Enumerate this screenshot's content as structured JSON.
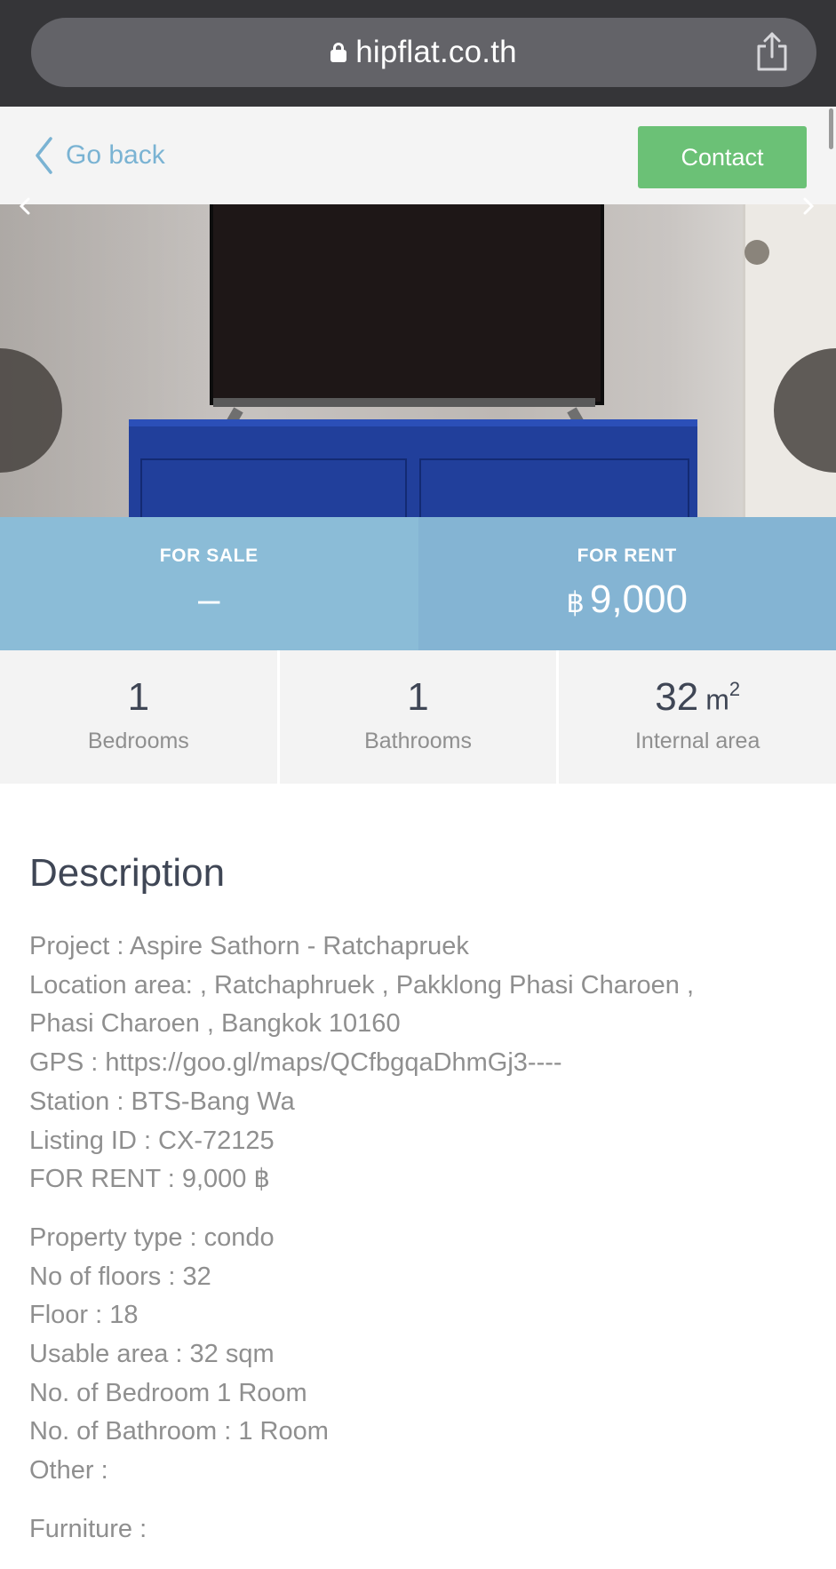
{
  "browser": {
    "url": "hipflat.co.th"
  },
  "header": {
    "back_label": "Go back",
    "contact_label": "Contact"
  },
  "prices": {
    "sale_label": "FOR SALE",
    "sale_value": "–",
    "rent_label": "FOR RENT",
    "rent_currency": "฿",
    "rent_value": "9,000"
  },
  "stats": {
    "bedrooms_value": "1",
    "bedrooms_label": "Bedrooms",
    "bathrooms_value": "1",
    "bathrooms_label": "Bathrooms",
    "area_value": "32",
    "area_unit": "m",
    "area_unit_exp": "2",
    "area_label": "Internal area"
  },
  "description": {
    "title": "Description",
    "group1": [
      "Project : Aspire Sathorn - Ratchapruek",
      "Location area: , Ratchaphruek , Pakklong Phasi Charoen ,",
      "Phasi Charoen , Bangkok 10160",
      "GPS : https://goo.gl/maps/QCfbgqaDhmGj3----",
      "Station : BTS-Bang Wa",
      "Listing ID : CX-72125",
      "FOR RENT : 9,000 ฿"
    ],
    "group2": [
      "Property type : condo",
      "No of floors : 32",
      "Floor : 18",
      "Usable area : 32 sqm",
      "No. of Bedroom 1 Room",
      "No. of Bathroom : 1 Room",
      "Other :"
    ],
    "group3": [
      "Furniture :"
    ]
  },
  "colors": {
    "contact_green": "#6bc176",
    "price_blue": "#8bbcd7",
    "link_blue": "#7ab3d3"
  }
}
